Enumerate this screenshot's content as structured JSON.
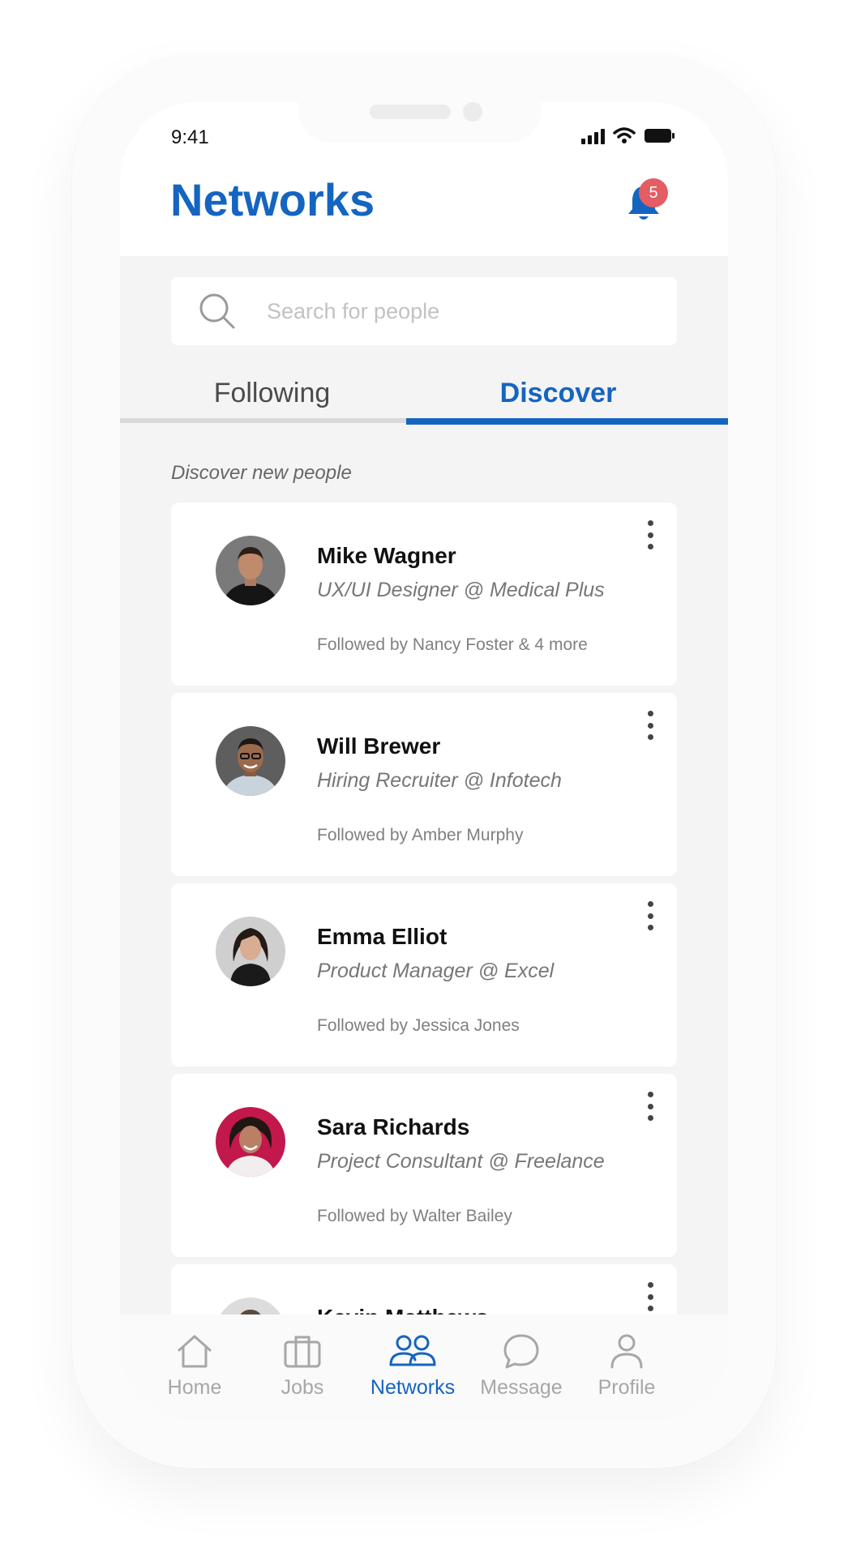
{
  "status_bar": {
    "time": "9:41"
  },
  "header": {
    "title": "Networks",
    "notification_count": "5"
  },
  "search": {
    "placeholder": "Search for people"
  },
  "tabs": [
    {
      "label": "Following",
      "active": false
    },
    {
      "label": "Discover",
      "active": true
    }
  ],
  "section_label": "Discover new people",
  "people": [
    {
      "name": "Mike Wagner",
      "role": "UX/UI Designer @ Medical Plus",
      "followed_by": "Followed by Nancy Foster & 4 more"
    },
    {
      "name": "Will Brewer",
      "role": "Hiring Recruiter @ Infotech",
      "followed_by": "Followed by Amber Murphy"
    },
    {
      "name": "Emma Elliot",
      "role": "Product Manager @ Excel",
      "followed_by": "Followed by Jessica Jones"
    },
    {
      "name": "Sara Richards",
      "role": "Project Consultant @ Freelance",
      "followed_by": "Followed by Walter Bailey"
    },
    {
      "name": "Kevin Matthews",
      "role": "",
      "followed_by": ""
    }
  ],
  "bottom_nav": [
    {
      "label": "Home",
      "icon": "home-icon",
      "active": false
    },
    {
      "label": "Jobs",
      "icon": "briefcase-icon",
      "active": false
    },
    {
      "label": "Networks",
      "icon": "people-icon",
      "active": true
    },
    {
      "label": "Message",
      "icon": "chat-bubble-icon",
      "active": false
    },
    {
      "label": "Profile",
      "icon": "user-icon",
      "active": false
    }
  ],
  "colors": {
    "accent": "#1565c0",
    "badge": "#e35d63",
    "background": "#f4f4f4"
  }
}
